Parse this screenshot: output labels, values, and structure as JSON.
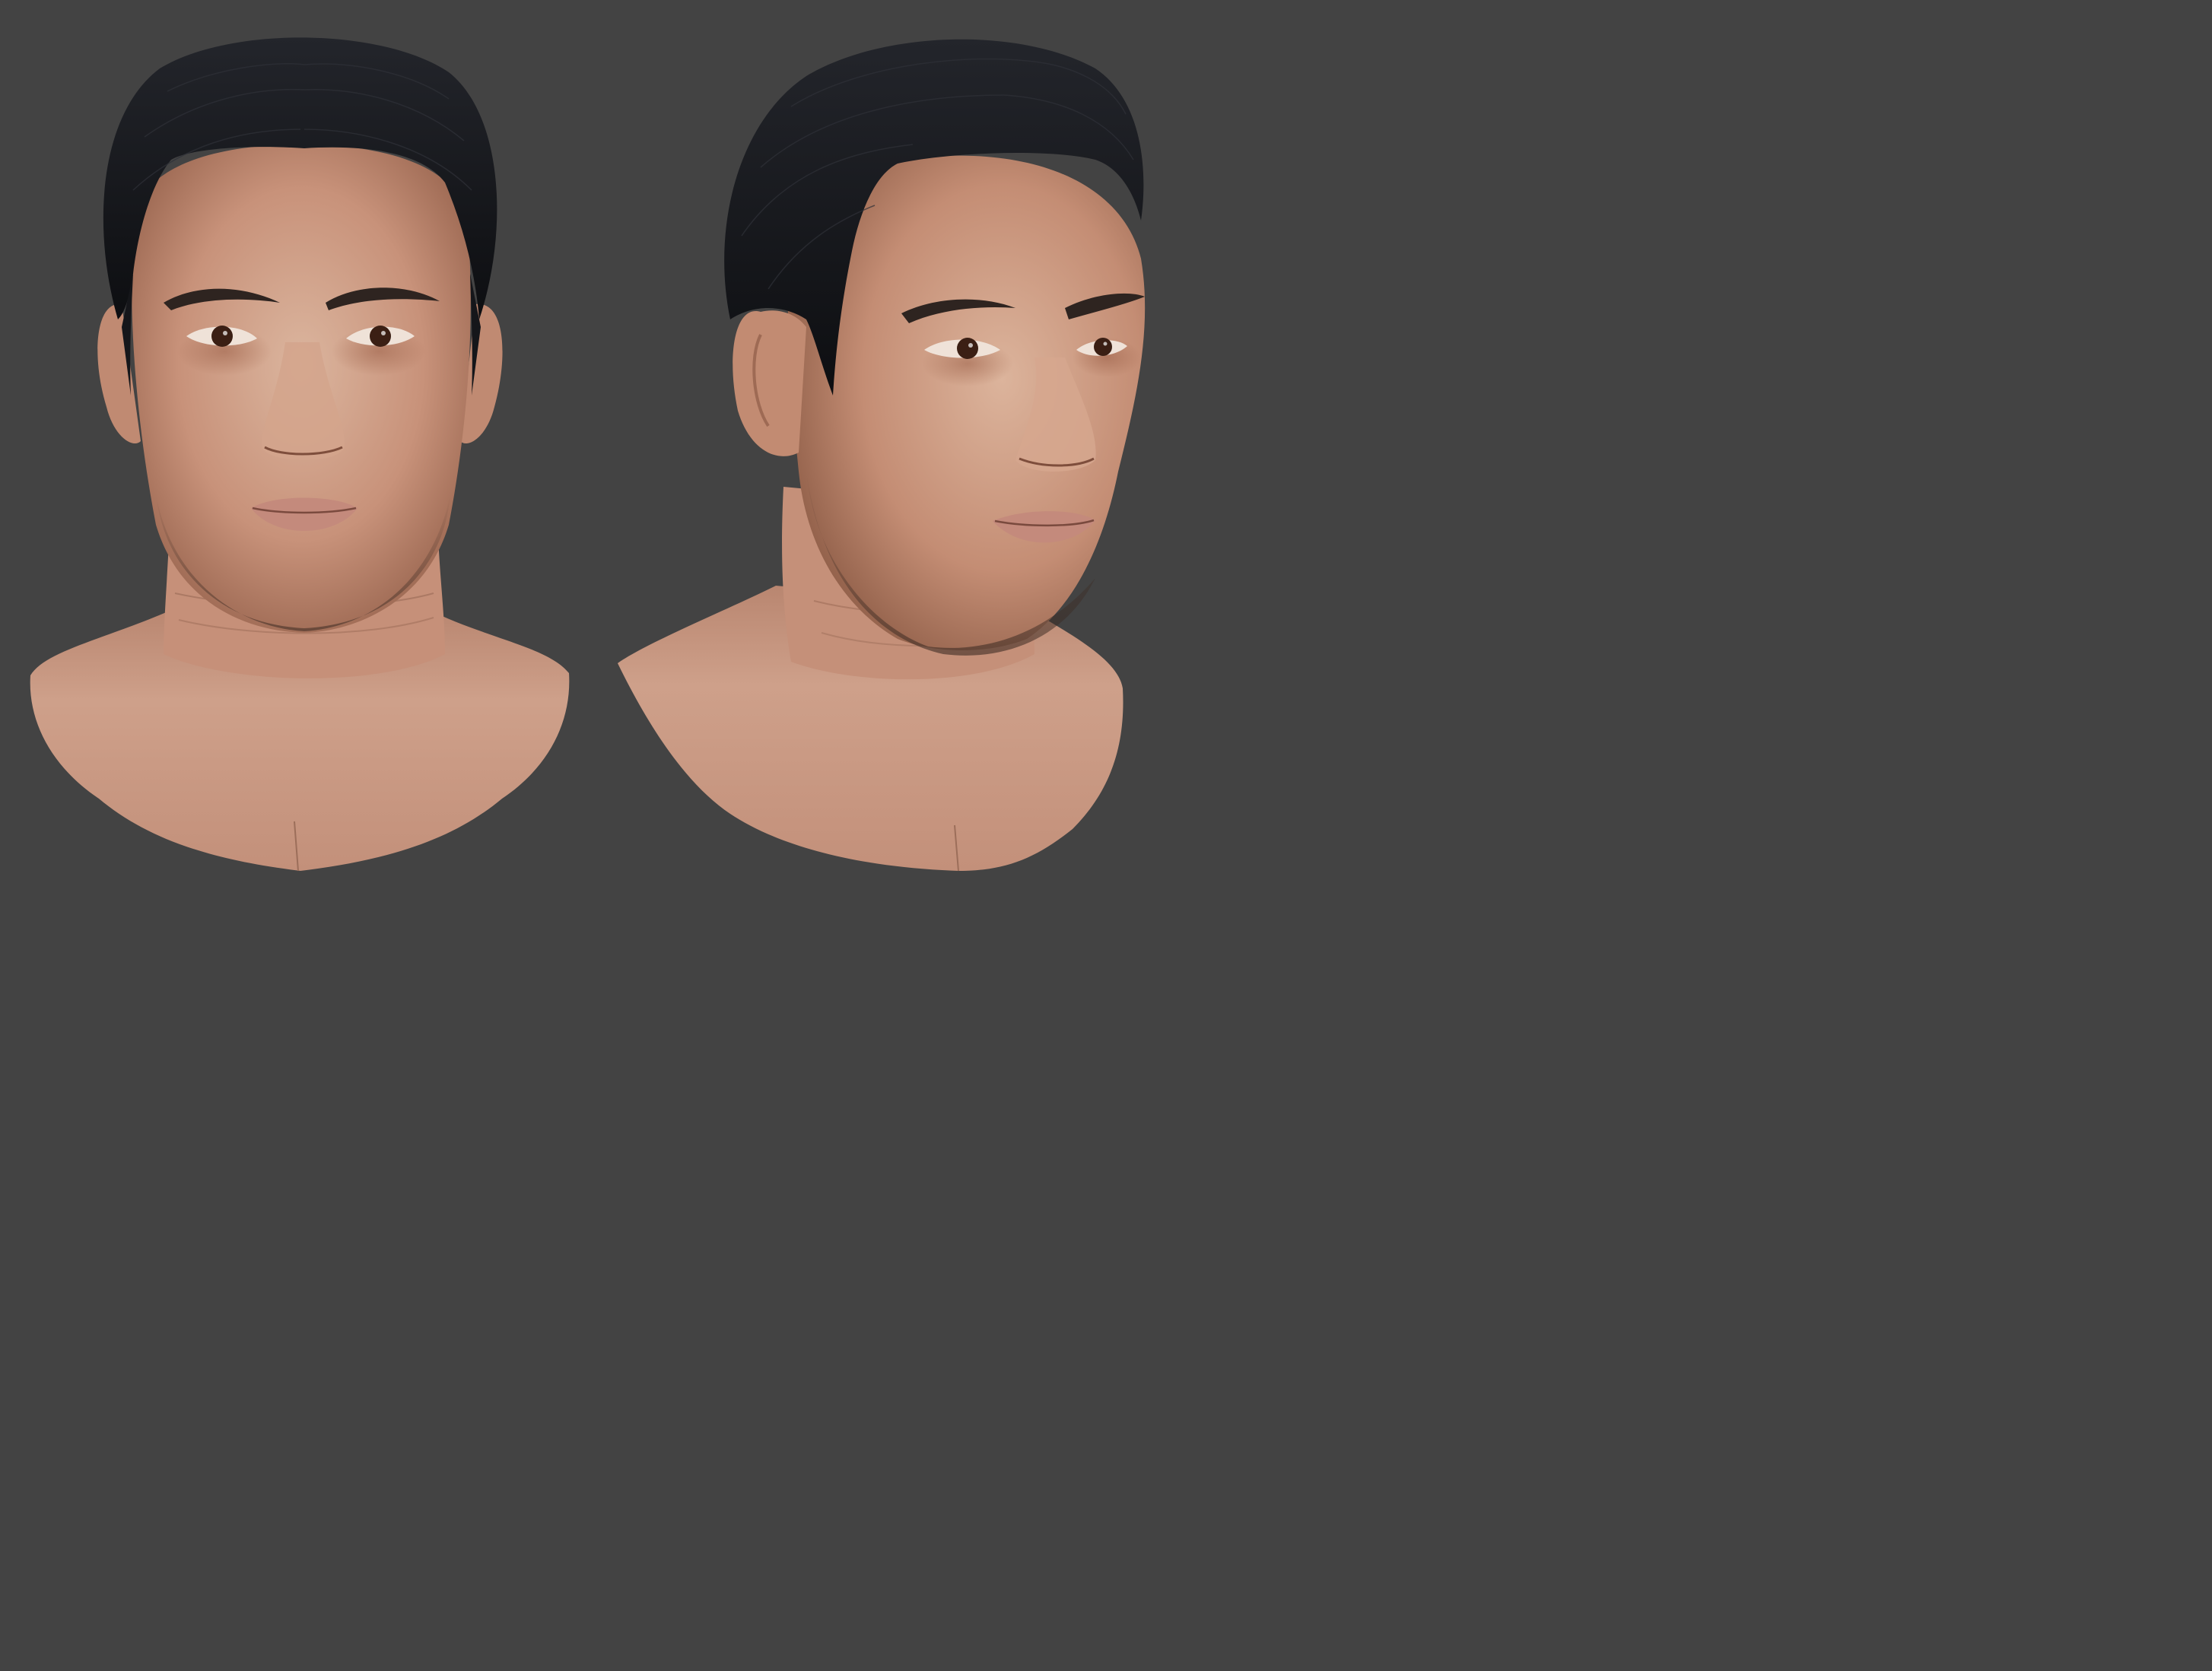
{
  "scene": {
    "background": "#434343",
    "views": [
      {
        "label": "",
        "angle": "front"
      },
      {
        "label": "",
        "angle": "three-quarter-right"
      }
    ],
    "colors": {
      "skin_light": "#d9b19a",
      "skin_mid": "#c58f76",
      "skin_shadow": "#8a5a45",
      "hair": "#15161a",
      "iris": "#3b1f14",
      "lips": "#c48a7c"
    }
  }
}
